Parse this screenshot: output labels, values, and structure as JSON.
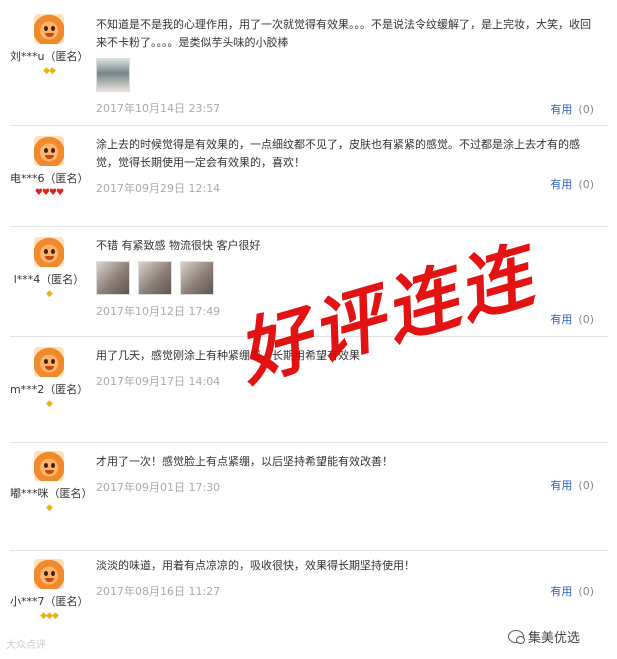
{
  "reviews": [
    {
      "username": "刘***u（匿名）",
      "badge": "◆◆",
      "badge_color": "gold",
      "text": "不知道是不是我的心理作用，用了一次就觉得有效果。。。不是说法令纹缓解了，是上完妆，大笑，收回来不卡粉了。。。。是类似芋头味的小胶棒",
      "photos": [
        "product-photo"
      ],
      "date": "2017年10月14日 23:57",
      "useful_label": "有用",
      "useful_count": "(0)"
    },
    {
      "username": "电***6（匿名）",
      "badge": "♥♥♥♥",
      "badge_color": "red",
      "text": "涂上去的时候觉得是有效果的，一点细纹都不见了，皮肤也有紧紧的感觉。不过都是涂上去才有的感觉，觉得长期使用一定会有效果的，喜欢！",
      "photos": [],
      "date": "2017年09月29日 12:14",
      "useful_label": "有用",
      "useful_count": "(0)"
    },
    {
      "username": "l***4（匿名）",
      "badge": "◆",
      "badge_color": "gold",
      "text": "不错 有紧致感 物流很快 客户很好",
      "photos": [
        "photo",
        "photo",
        "photo"
      ],
      "date": "2017年10月12日 17:49",
      "useful_label": "有用",
      "useful_count": "(0)"
    },
    {
      "username": "m***2（匿名）",
      "badge": "◆",
      "badge_color": "gold",
      "text": "用了几天，感觉刚涂上有种紧绷感，长期用希望有效果",
      "photos": [],
      "date": "2017年09月17日 14:04",
      "useful_label": "",
      "useful_count": ""
    },
    {
      "username": "嘟***咪（匿名）",
      "badge": "◆",
      "badge_color": "gold",
      "text": "才用了一次！感觉脸上有点紧绷，以后坚持希望能有效改善！",
      "photos": [],
      "date": "2017年09月01日 17:30",
      "useful_label": "有用",
      "useful_count": "(0)"
    },
    {
      "username": "小***7（匿名）",
      "badge": "◆◆◆",
      "badge_color": "gold",
      "text": "淡淡的味道，用着有点凉凉的，吸收很快，效果得长期坚持使用！",
      "photos": [],
      "date": "2017年08月16日 11:27",
      "useful_label": "有用",
      "useful_count": "(0)"
    }
  ],
  "overlay_text": "好评连连",
  "footer": {
    "left": "大众点评",
    "right": "集美优选"
  },
  "colors": {
    "link": "#2a62c4",
    "overlay": "#e10000",
    "date": "#aaaaaa"
  }
}
